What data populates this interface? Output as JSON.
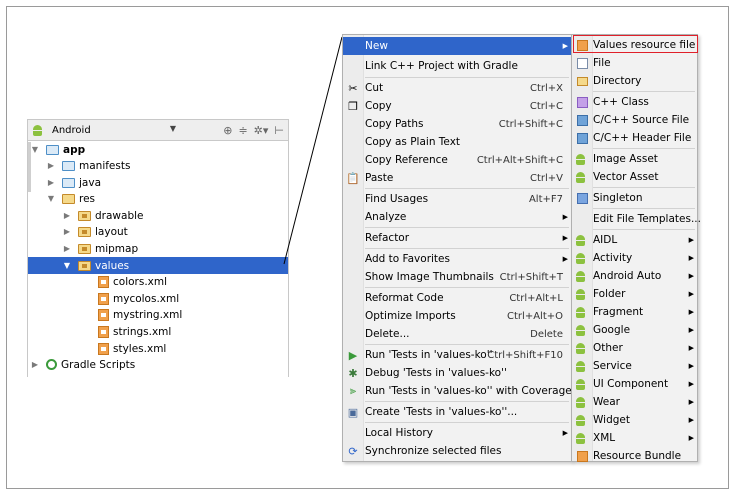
{
  "tree": {
    "combo_label": "Android",
    "rows": [
      {
        "label": "app",
        "level": 0,
        "expanded": true,
        "icon": "module-folder-icon",
        "bold": true
      },
      {
        "label": "manifests",
        "level": 1,
        "expanded": false,
        "icon": "folder-icon"
      },
      {
        "label": "java",
        "level": 1,
        "expanded": false,
        "icon": "folder-icon"
      },
      {
        "label": "res",
        "level": 1,
        "expanded": true,
        "icon": "res-folder-icon"
      },
      {
        "label": "drawable",
        "level": 2,
        "expanded": false,
        "icon": "res-subfolder-icon"
      },
      {
        "label": "layout",
        "level": 2,
        "expanded": false,
        "icon": "res-subfolder-icon"
      },
      {
        "label": "mipmap",
        "level": 2,
        "expanded": false,
        "icon": "res-subfolder-icon"
      },
      {
        "label": "values",
        "level": 2,
        "expanded": true,
        "icon": "res-subfolder-icon",
        "selected": true
      },
      {
        "label": "colors.xml",
        "level": 3,
        "icon": "xml-file-icon"
      },
      {
        "label": "mycolos.xml",
        "level": 3,
        "icon": "xml-file-icon"
      },
      {
        "label": "mystring.xml",
        "level": 3,
        "icon": "xml-file-icon"
      },
      {
        "label": "strings.xml",
        "level": 3,
        "icon": "xml-file-icon"
      },
      {
        "label": "styles.xml",
        "level": 3,
        "icon": "xml-file-icon"
      },
      {
        "label": "Gradle Scripts",
        "level": 0,
        "expanded": false,
        "icon": "gradle-icon"
      }
    ]
  },
  "menu": {
    "items": [
      {
        "label": "New",
        "submenu": true,
        "highlighted": true
      },
      {
        "label": "Link C++ Project with Gradle"
      },
      {
        "label": "Cut",
        "shortcut": "Ctrl+X",
        "icon": "scissors-icon"
      },
      {
        "label": "Copy",
        "shortcut": "Ctrl+C",
        "icon": "copy-icon"
      },
      {
        "label": "Copy Paths",
        "shortcut": "Ctrl+Shift+C"
      },
      {
        "label": "Copy as Plain Text"
      },
      {
        "label": "Copy Reference",
        "shortcut": "Ctrl+Alt+Shift+C"
      },
      {
        "label": "Paste",
        "shortcut": "Ctrl+V",
        "icon": "paste-icon"
      },
      {
        "label": "Find Usages",
        "shortcut": "Alt+F7"
      },
      {
        "label": "Analyze",
        "submenu": true
      },
      {
        "label": "Refactor",
        "submenu": true
      },
      {
        "label": "Add to Favorites",
        "submenu": true
      },
      {
        "label": "Show Image Thumbnails",
        "shortcut": "Ctrl+Shift+T"
      },
      {
        "label": "Reformat Code",
        "shortcut": "Ctrl+Alt+L"
      },
      {
        "label": "Optimize Imports",
        "shortcut": "Ctrl+Alt+O"
      },
      {
        "label": "Delete...",
        "shortcut": "Delete"
      },
      {
        "label": "Run 'Tests in 'values-ko''",
        "shortcut": "Ctrl+Shift+F10",
        "icon": "run-icon"
      },
      {
        "label": "Debug 'Tests in 'values-ko''",
        "icon": "debug-icon"
      },
      {
        "label": "Run 'Tests in 'values-ko'' with Coverage",
        "icon": "coverage-icon"
      },
      {
        "label": "Create 'Tests in 'values-ko''...",
        "icon": "create-test-icon"
      },
      {
        "label": "Local History",
        "submenu": true
      },
      {
        "label": "Synchronize selected files",
        "icon": "sync-icon"
      }
    ]
  },
  "submenu": {
    "items": [
      {
        "label": "Values resource file",
        "icon": "xml",
        "boxed": true
      },
      {
        "label": "File",
        "icon": "file"
      },
      {
        "label": "Directory",
        "icon": "dir"
      },
      {
        "label": "C++ Class",
        "icon": "cls"
      },
      {
        "label": "C/C++ Source File",
        "icon": "cpp"
      },
      {
        "label": "C/C++ Header File",
        "icon": "cpp"
      },
      {
        "label": "Image Asset",
        "icon": "droid"
      },
      {
        "label": "Vector Asset",
        "icon": "droid"
      },
      {
        "label": "Singleton",
        "icon": "single"
      },
      {
        "label": "Edit File Templates...",
        "icon": "none"
      },
      {
        "label": "AIDL",
        "icon": "droid",
        "submenu": true
      },
      {
        "label": "Activity",
        "icon": "droid",
        "submenu": true
      },
      {
        "label": "Android Auto",
        "icon": "droid",
        "submenu": true
      },
      {
        "label": "Folder",
        "icon": "droid",
        "submenu": true
      },
      {
        "label": "Fragment",
        "icon": "droid",
        "submenu": true
      },
      {
        "label": "Google",
        "icon": "droid",
        "submenu": true
      },
      {
        "label": "Other",
        "icon": "droid",
        "submenu": true
      },
      {
        "label": "Service",
        "icon": "droid",
        "submenu": true
      },
      {
        "label": "UI Component",
        "icon": "droid",
        "submenu": true
      },
      {
        "label": "Wear",
        "icon": "droid",
        "submenu": true
      },
      {
        "label": "Widget",
        "icon": "droid",
        "submenu": true
      },
      {
        "label": "XML",
        "icon": "droid",
        "submenu": true
      },
      {
        "label": "Resource Bundle",
        "icon": "bundle"
      }
    ]
  },
  "colors": {
    "selection": "#2f65ca",
    "highlight_box": "#e0202a",
    "android_green": "#8cc13f"
  }
}
